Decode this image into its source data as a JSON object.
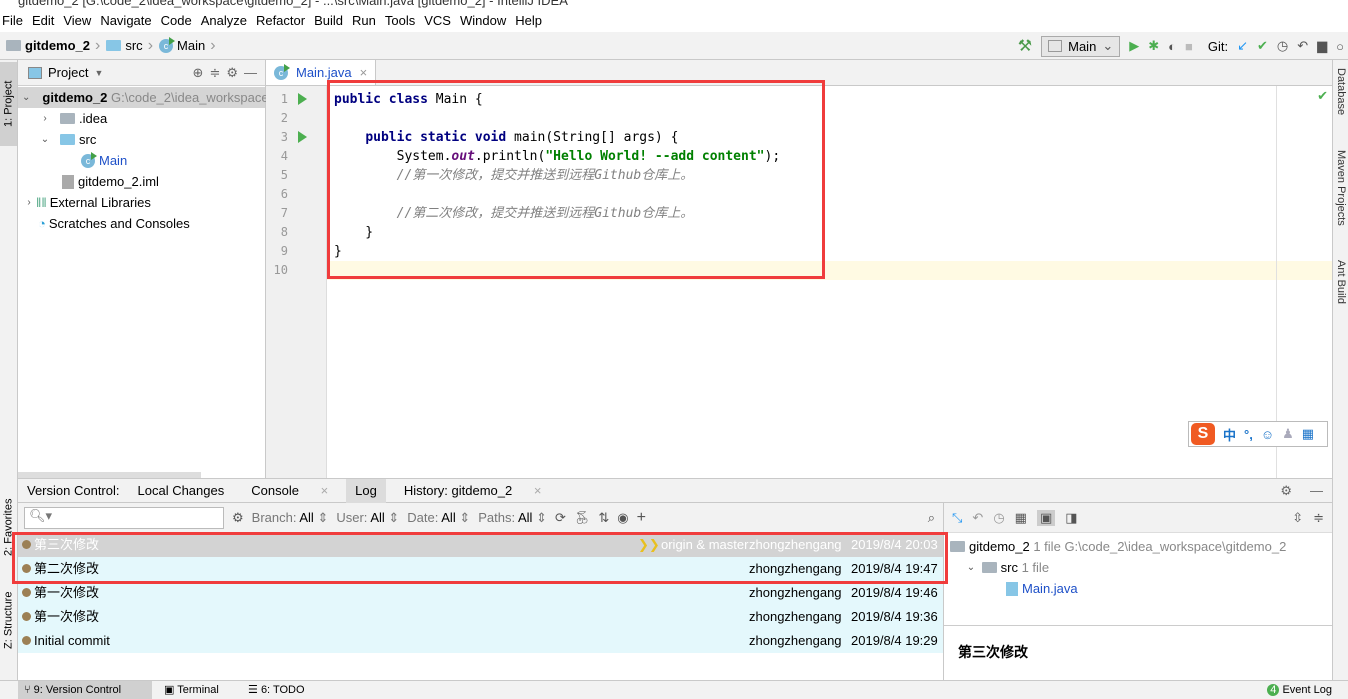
{
  "window": {
    "title": "gitdemo_2 [G:\\code_2\\idea_workspace\\gitdemo_2] - ...\\src\\Main.java [gitdemo_2] - IntelliJ IDEA"
  },
  "menu": [
    "File",
    "Edit",
    "View",
    "Navigate",
    "Code",
    "Analyze",
    "Refactor",
    "Build",
    "Run",
    "Tools",
    "VCS",
    "Window",
    "Help"
  ],
  "breadcrumb": [
    "gitdemo_2",
    "src",
    "Main"
  ],
  "toolbar": {
    "run_config": "Main",
    "git_label": "Git:"
  },
  "left_strip": {
    "project": "1: Project",
    "favorites": "2: Favorites",
    "structure": "Z: Structure"
  },
  "right_strip": [
    "Database",
    "Maven Projects",
    "Ant Build"
  ],
  "project": {
    "title": "Project",
    "tree": [
      {
        "label": "gitdemo_2",
        "extra": "G:\\code_2\\idea_workspace\\gitdemo_2"
      },
      {
        "label": ".idea"
      },
      {
        "label": "src"
      },
      {
        "label": "Main"
      },
      {
        "label": "gitdemo_2.iml"
      },
      {
        "label": "External Libraries"
      },
      {
        "label": "Scratches and Consoles"
      }
    ]
  },
  "editor": {
    "tab": "Main.java",
    "lines": [
      "public class Main {",
      "",
      "    public static void main(String[] args) {",
      "        System.out.println(\"Hello World! --add content\");",
      "        //第一次修改，提交并推送到远程Github仓库上。",
      "",
      "        //第二次修改，提交并推送到远程Github仓库上。",
      "    }",
      "}",
      ""
    ]
  },
  "ime": {
    "logo": "S",
    "mode": "中",
    "punct": "°,"
  },
  "vc": {
    "tabs": [
      "Version Control:",
      "Local Changes",
      "Console",
      "Log",
      "History: gitdemo_2"
    ],
    "filters": {
      "branch": "Branch:",
      "user": "User:",
      "date": "Date:",
      "paths": "Paths:",
      "value": "All"
    },
    "commits": [
      {
        "message": "第三次修改",
        "refs": "origin & master",
        "author": "zhongzhengang",
        "date": "2019/8/4 20:03"
      },
      {
        "message": "第二次修改",
        "author": "zhongzhengang",
        "date": "2019/8/4 19:47"
      },
      {
        "message": "第一次修改",
        "author": "zhongzhengang",
        "date": "2019/8/4 19:46"
      },
      {
        "message": "第一次修改",
        "author": "zhongzhengang",
        "date": "2019/8/4 19:36"
      },
      {
        "message": "Initial commit",
        "author": "zhongzhengang",
        "date": "2019/8/4 19:29"
      }
    ],
    "details": {
      "root": "gitdemo_2",
      "root_count": "1 file",
      "root_path": "G:\\code_2\\idea_workspace\\gitdemo_2",
      "src": "src",
      "src_count": "1 file",
      "file": "Main.java",
      "message": "第三次修改"
    }
  },
  "statusbar": {
    "vc": "9: Version Control",
    "terminal": "Terminal",
    "todo": "6: TODO",
    "event_count": "4",
    "event_log": "Event Log"
  },
  "colors": {
    "accent": "#1e50c8",
    "highlight_box": "#f03c3c",
    "log_row": "#e4f8fc",
    "graph": "#9c8055"
  }
}
